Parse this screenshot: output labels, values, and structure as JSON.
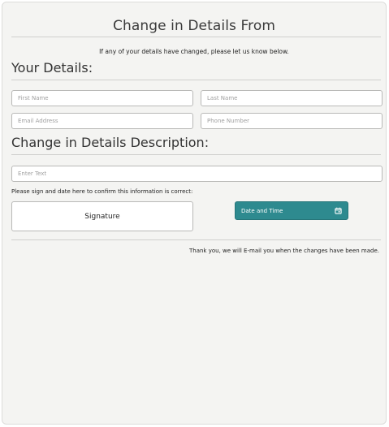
{
  "form": {
    "title": "Change in Details From",
    "intro": "If any of your details have changed, please let us know below.",
    "your_details_heading": "Your Details:",
    "fields": {
      "first_name_placeholder": "First Name",
      "last_name_placeholder": "Last Name",
      "email_placeholder": "Email Address",
      "phone_placeholder": "Phone Number"
    },
    "description_heading": "Change in Details Description:",
    "description_placeholder": "Enter Text",
    "confirm_text": "Please sign and date here to confirm this information is correct:",
    "signature_label": "Signature",
    "datetime_label": "Date and Time",
    "thanks_text": "Thank you, we will E-mail you when the changes have been made."
  },
  "icons": {
    "datetime_icon": "calendar-icon"
  },
  "colors": {
    "background": "#f4f4f2",
    "accent": "#2e8a8f",
    "field_border": "#b9b9b7"
  }
}
